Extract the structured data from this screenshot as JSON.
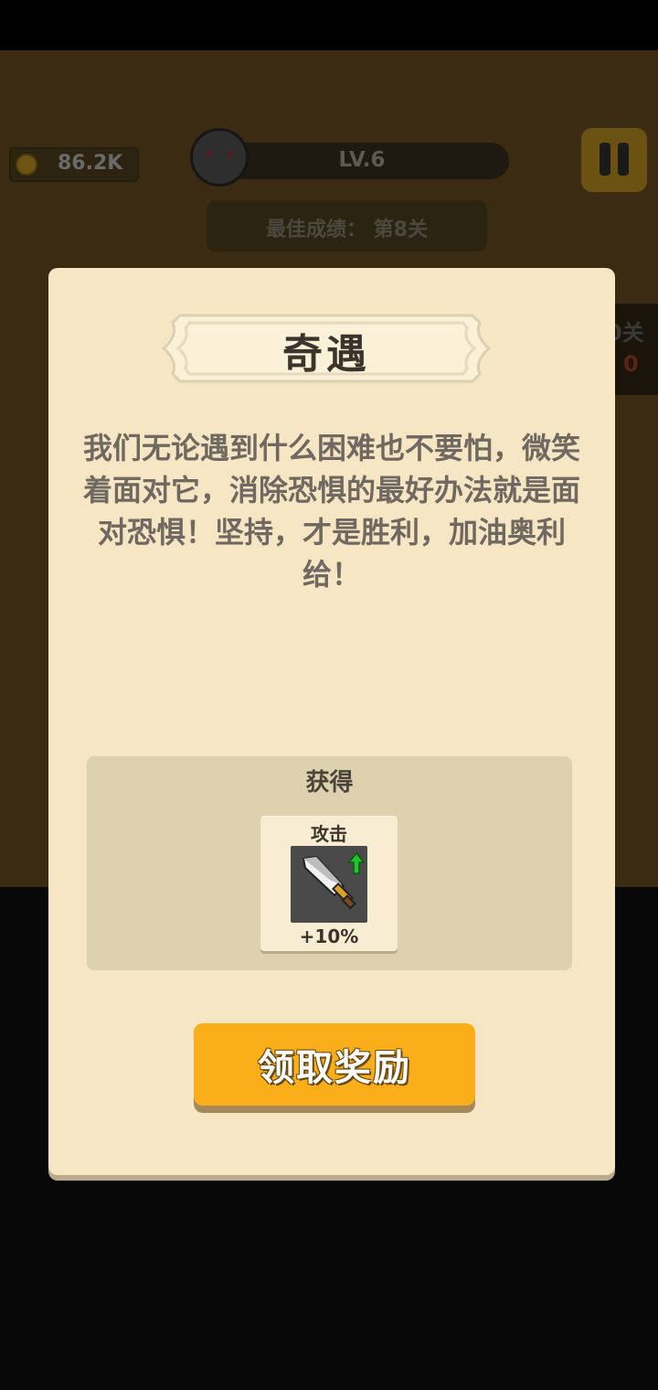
{
  "hud": {
    "coins": "86.2K",
    "level": "LV.6",
    "best_score": "最佳成绩： 第8关",
    "side_panel_label": "0关",
    "side_panel_value": "0"
  },
  "dialog": {
    "title": "奇遇",
    "story": "我们无论遇到什么困难也不要怕，微笑着面对它，消除恐惧的最好办法就是面对恐惧！坚持，才是胜利，加油奥利给！",
    "reward_title": "获得",
    "reward": {
      "label": "攻击",
      "icon": "sword-icon",
      "value": "+10%"
    },
    "claim_label": "领取奖励"
  },
  "colors": {
    "dialog_bg": "#f7e6c3",
    "button_accent": "#f9ae1a",
    "arrow_green": "#22c52a"
  }
}
